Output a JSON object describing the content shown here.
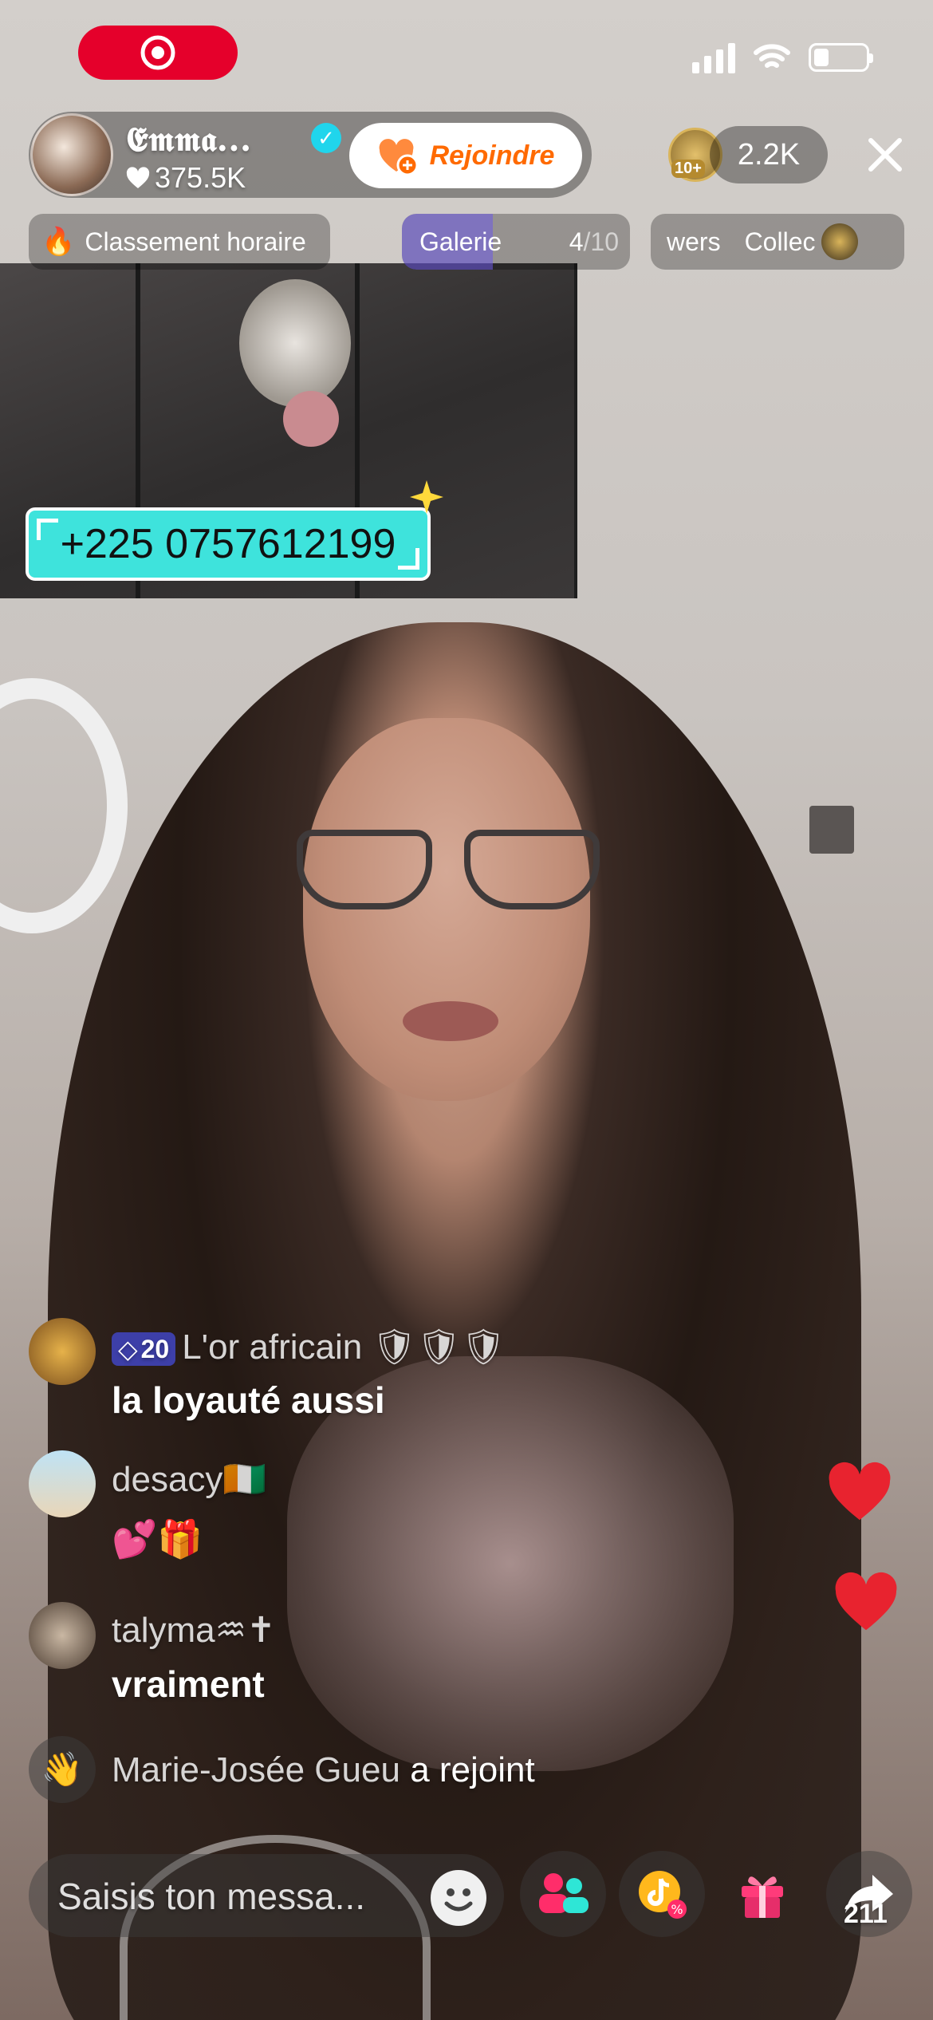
{
  "status_bar": {
    "recording_icon": "target-icon",
    "signal_icon": "signal-icon",
    "wifi_icon": "wifi-icon",
    "battery_icon": "battery-icon"
  },
  "host": {
    "name": "𝕰𝖒𝖒𝖆...",
    "verified_icon": "verified-check-icon",
    "likes": "375.5K",
    "join_label": "Rejoindre"
  },
  "viewers": {
    "badge": "10+",
    "count": "2.2K"
  },
  "chips": {
    "ranking_label": "Classement horaire",
    "gallery_label": "Galerie",
    "gallery_progress": "4",
    "gallery_total": "/10",
    "gallery_fraction": 0.4,
    "ticker_left": "wers",
    "ticker_right": "Collec"
  },
  "sticker": {
    "phone": "+225 0757612199"
  },
  "chat": [
    {
      "badge_level": "20",
      "username": "L'or africain",
      "suffix": "🛡🛡🛡",
      "message": "la loyauté aussi"
    },
    {
      "username": "desacy🇨🇮",
      "message": "💕🎁"
    },
    {
      "username": "talyma♒✝",
      "message": "vraiment"
    }
  ],
  "join_notice": {
    "name": "Marie-Josée Gueu",
    "action": "a rejoint"
  },
  "bottom": {
    "input_placeholder": "Saisis ton messa...",
    "share_count": "211"
  },
  "colors": {
    "accent_red": "#e5002b",
    "join_orange": "#ff6a00",
    "sticker_cyan": "#3ee3dc",
    "heart_red": "#e8232f",
    "verified_blue": "#20d5ec"
  }
}
